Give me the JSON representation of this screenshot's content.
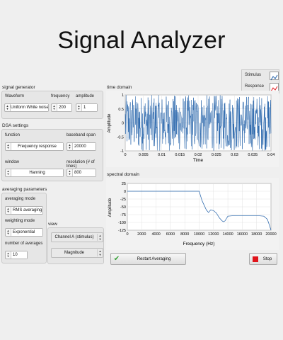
{
  "title": "Signal Analyzer",
  "signal_generator": {
    "label": "signal generator",
    "waveform_label": "Waveform",
    "waveform_value": "Uniform White noise",
    "frequency_label": "frequency",
    "frequency_value": "200",
    "amplitude_label": "amplitude",
    "amplitude_value": "1"
  },
  "dsa": {
    "label": "DSA settings",
    "function_label": "function",
    "function_value": "Frequency response",
    "span_label": "baseband span",
    "span_value": "20000",
    "window_label": "window",
    "window_value": "Hanning",
    "resolution_label": "resolution (# of lines)",
    "resolution_value": "800"
  },
  "averaging": {
    "label": "averaging parameters",
    "mode_label": "averaging mode",
    "mode_value": "RMS averaging",
    "weighting_label": "weighting mode",
    "weighting_value": "Exponential",
    "count_label": "number of averages",
    "count_value": "10"
  },
  "view": {
    "label": "view",
    "channel_value": "Channel A (stimulus)",
    "display_value": "Magnitude"
  },
  "legend": {
    "stimulus": "Stimulus",
    "response": "Response"
  },
  "time_domain": {
    "label": "time domain",
    "xlabel": "Time",
    "ylabel": "Amplitude",
    "xticks": [
      "0",
      "0.005",
      "0.01",
      "0.015",
      "0.02",
      "0.025",
      "0.03",
      "0.035",
      "0.04"
    ],
    "yticks": [
      "1",
      "0.5",
      "0",
      "-0.5",
      "-1"
    ]
  },
  "spectral_domain": {
    "label": "spectral domain",
    "xlabel": "Frequency (Hz)",
    "ylabel": "Amplitude",
    "xticks": [
      "0",
      "2000",
      "4000",
      "6000",
      "8000",
      "10000",
      "12000",
      "14000",
      "16000",
      "18000",
      "20000"
    ],
    "yticks": [
      "25",
      "0",
      "-25",
      "-50",
      "-75",
      "-100",
      "-125"
    ]
  },
  "buttons": {
    "restart": "Restart Averaging",
    "stop": "Stop"
  },
  "colors": {
    "signal": "#1f5fa8",
    "stop": "#e0141b",
    "check": "#3aa33a"
  },
  "chart_data": [
    {
      "type": "line",
      "title": "time domain",
      "xlabel": "Time",
      "ylabel": "Amplitude",
      "xlim": [
        0,
        0.04
      ],
      "ylim": [
        -1,
        1
      ],
      "grid": true,
      "series": [
        {
          "name": "Stimulus",
          "description_values": "uniform white noise, amplitude 1, spanning -1 to 1"
        }
      ]
    },
    {
      "type": "line",
      "title": "spectral domain",
      "xlabel": "Frequency (Hz)",
      "ylabel": "Amplitude",
      "xlim": [
        0,
        20000
      ],
      "ylim": [
        -125,
        25
      ],
      "grid": true,
      "series": [
        {
          "name": "Stimulus",
          "x": [
            0,
            2000,
            4000,
            6000,
            8000,
            10000,
            10400,
            11000,
            11300,
            11600,
            12000,
            12400,
            12800,
            13200,
            13400,
            13600,
            14000,
            15000,
            16000,
            17000,
            18000,
            19000,
            19500,
            19800,
            20000
          ],
          "y": [
            0,
            0,
            0,
            0,
            0,
            0,
            -30,
            -60,
            -68,
            -60,
            -62,
            -70,
            -85,
            -95,
            -98,
            -95,
            -80,
            -78,
            -78,
            -78,
            -78,
            -80,
            -90,
            -110,
            -125
          ]
        }
      ]
    }
  ]
}
